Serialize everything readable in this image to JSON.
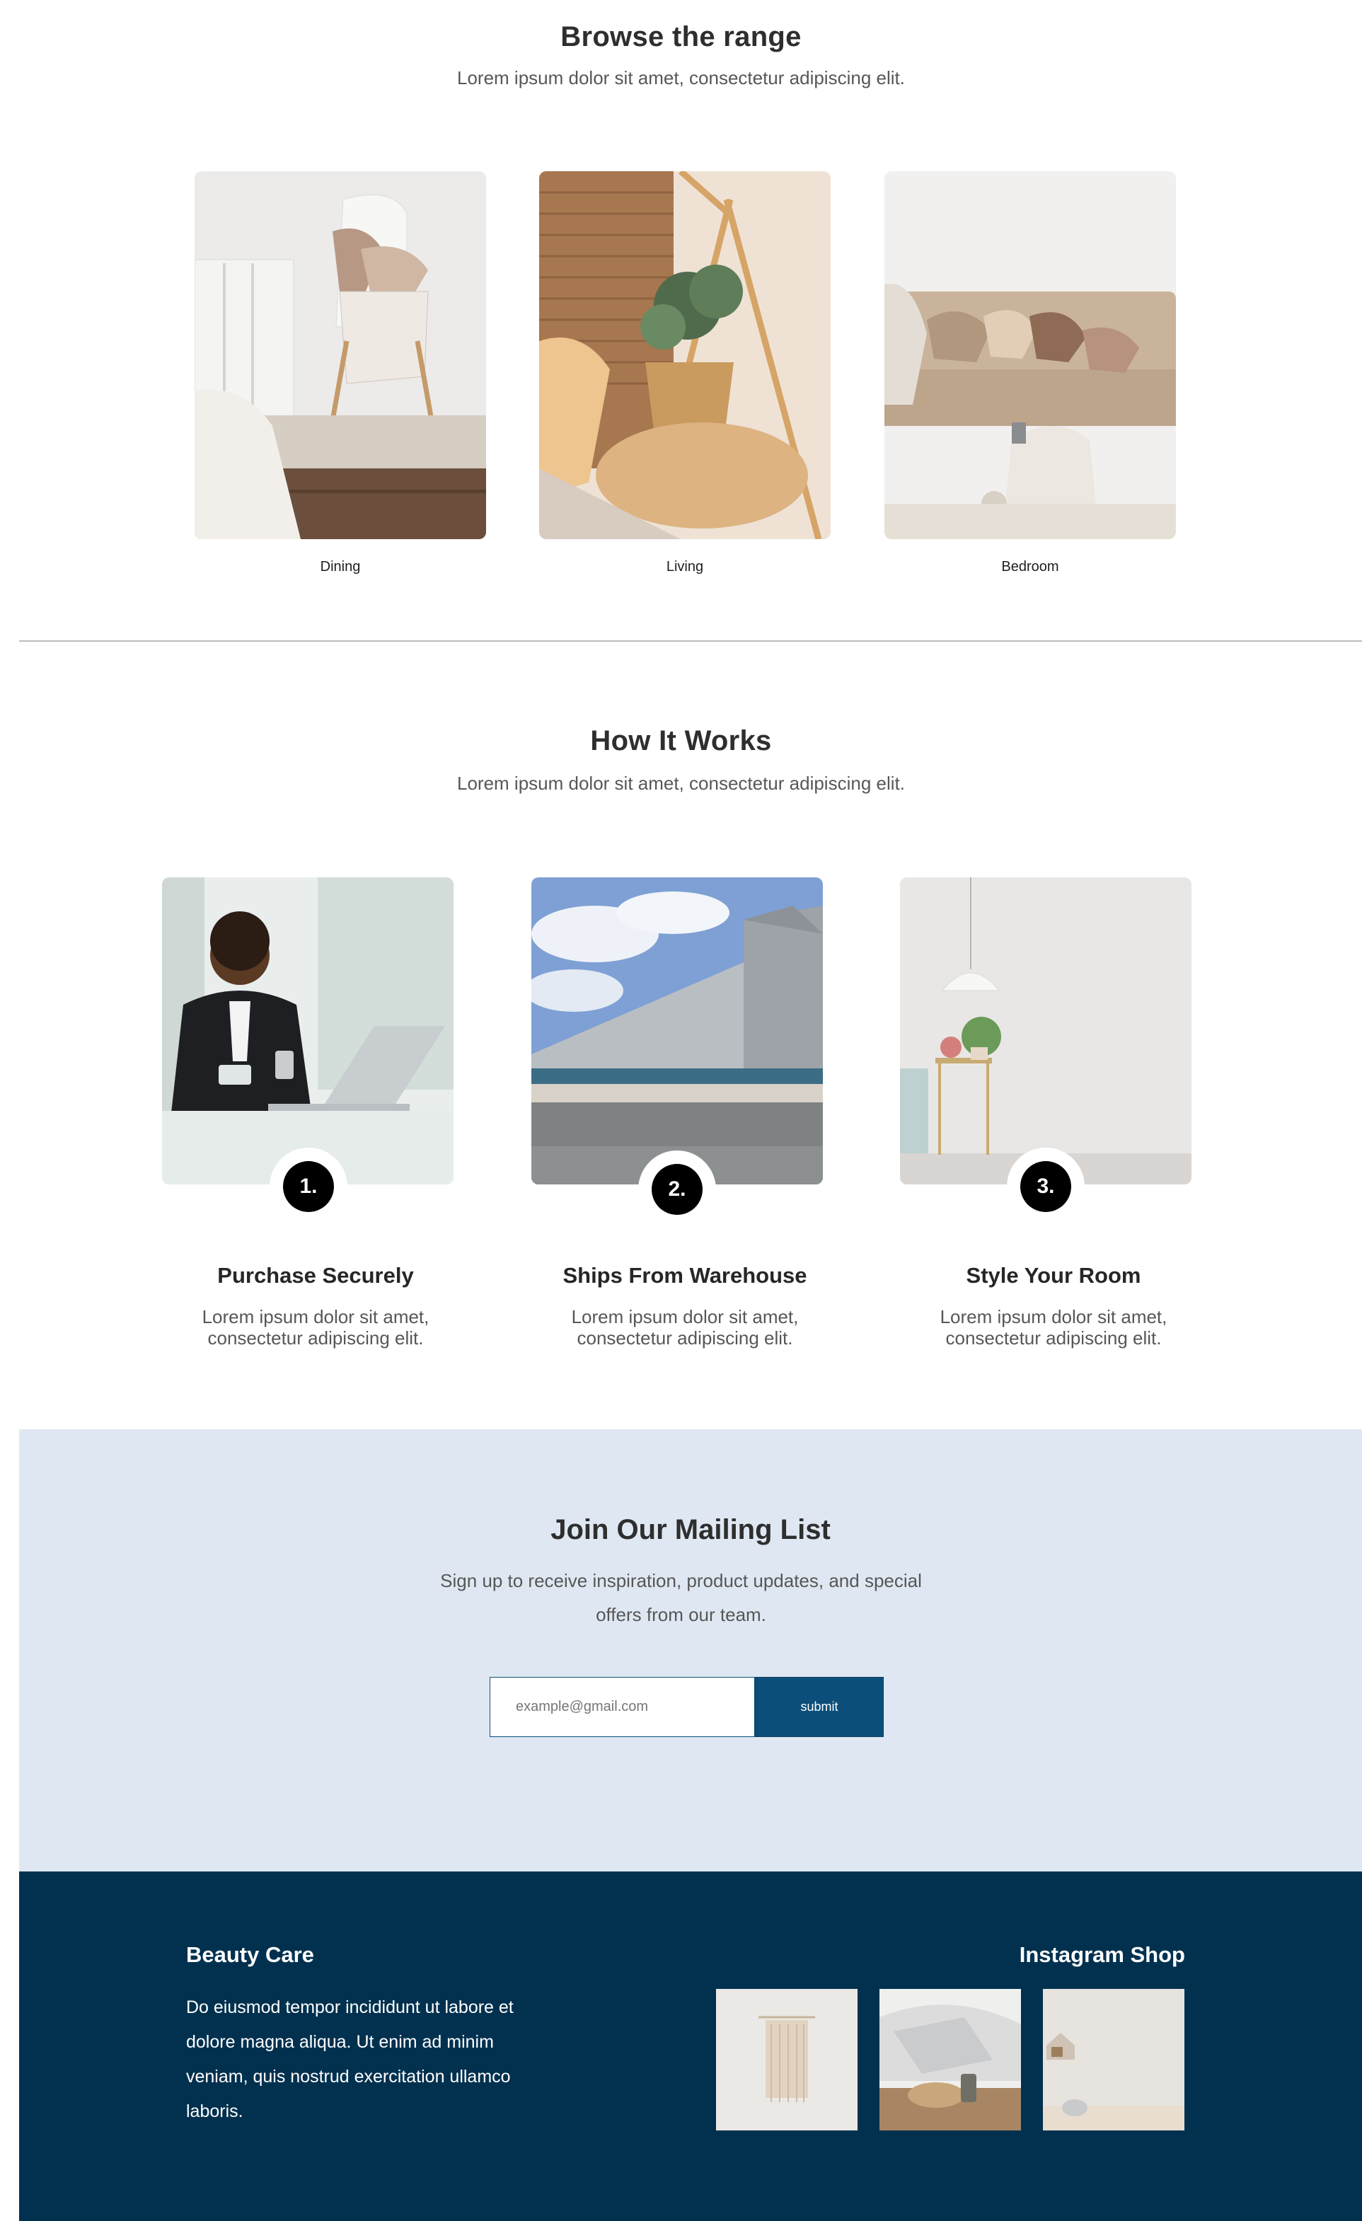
{
  "browse": {
    "title": "Browse the range",
    "subtitle": "Lorem ipsum dolor sit amet, consectetur adipiscing elit.",
    "items": [
      {
        "label": "Dining"
      },
      {
        "label": "Living"
      },
      {
        "label": "Bedroom"
      }
    ]
  },
  "how": {
    "title": "How It Works",
    "subtitle": "Lorem ipsum dolor sit amet, consectetur adipiscing elit.",
    "steps": [
      {
        "number": "1.",
        "title": "Purchase Securely",
        "text": "Lorem ipsum dolor sit amet, consectetur adipiscing elit."
      },
      {
        "number": "2.",
        "title": "Ships From Warehouse",
        "text": "Lorem ipsum dolor sit amet, consectetur adipiscing elit."
      },
      {
        "number": "3.",
        "title": "Style Your Room",
        "text": "Lorem ipsum dolor sit amet, consectetur adipiscing elit."
      }
    ]
  },
  "mailing": {
    "title": "Join Our Mailing List",
    "text": "Sign up to receive inspiration, product updates, and special offers from our team.",
    "placeholder": "example@gmail.com",
    "submit": "submit"
  },
  "footer": {
    "brand": "Beauty Care",
    "text": "Do eiusmod tempor incididunt ut labore et dolore magna aliqua. Ut enim ad minim veniam, quis nostrud exercitation ullamco laboris.",
    "instagram_title": "Instagram Shop"
  },
  "colors": {
    "mailing_bg": "#dfe8f2",
    "footer_bg": "#02314f",
    "accent": "#0b4e79"
  }
}
